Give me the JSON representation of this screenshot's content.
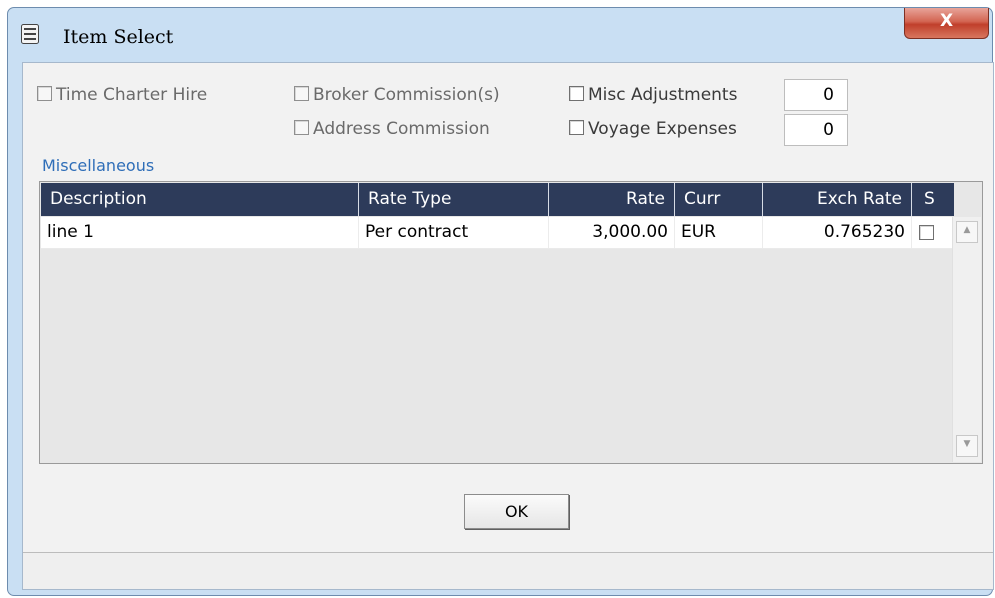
{
  "window": {
    "title": "Item Select",
    "close_label": "X"
  },
  "options": {
    "time_charter_hire": "Time Charter Hire",
    "broker_commission": "Broker Commission(s)",
    "address_commission": "Address Commission",
    "misc_adjustments": "Misc Adjustments",
    "misc_adjustments_value": "0",
    "voyage_expenses": "Voyage Expenses",
    "voyage_expenses_value": "0"
  },
  "section": {
    "label": "Miscellaneous"
  },
  "grid": {
    "columns": [
      "Description",
      "Rate Type",
      "Rate",
      "Curr",
      "Exch Rate",
      "S"
    ],
    "rows": [
      {
        "description": "line 1",
        "rate_type": "Per contract",
        "rate": "3,000.00",
        "curr": "EUR",
        "exch_rate": "0.765230",
        "s": false
      }
    ]
  },
  "footer": {
    "ok_label": "OK"
  }
}
